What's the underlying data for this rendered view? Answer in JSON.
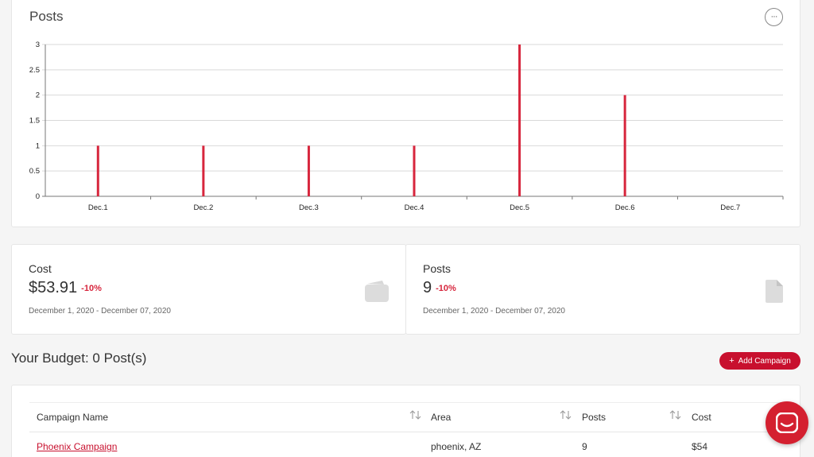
{
  "posts_chart": {
    "title": "Posts",
    "more_icon_glyph": "···",
    "chart_data": {
      "type": "bar",
      "categories": [
        "Dec.1",
        "Dec.2",
        "Dec.3",
        "Dec.4",
        "Dec.5",
        "Dec.6",
        "Dec.7"
      ],
      "values": [
        1,
        1,
        1,
        1,
        3,
        2,
        0
      ],
      "yticks": [
        "0",
        "0.5",
        "1",
        "1.5",
        "2",
        "2.5",
        "3"
      ],
      "ylim": [
        0,
        3
      ],
      "grid": true,
      "bar_color": "#d7263d"
    }
  },
  "stats": {
    "cost": {
      "label": "Cost",
      "value": "$53.91",
      "change": "-10%",
      "range": "December 1, 2020 - December 07, 2020",
      "icon": "wallet-icon"
    },
    "posts": {
      "label": "Posts",
      "value": "9",
      "change": "-10%",
      "range": "December 1, 2020 - December 07, 2020",
      "icon": "document-icon"
    }
  },
  "budget": {
    "title": "Your Budget: 0 Post(s)",
    "add_button_plus": "+",
    "add_button_label": "Add Campaign"
  },
  "table": {
    "headers": {
      "campaign_name": "Campaign Name",
      "area": "Area",
      "posts": "Posts",
      "cost": "Cost"
    },
    "rows": [
      {
        "campaign_name": "Phoenix Campaign",
        "area": "phoenix, AZ",
        "posts": "9",
        "cost": "$54"
      }
    ]
  },
  "colors": {
    "accent": "#c8102e",
    "change_negative": "#d7263d"
  }
}
